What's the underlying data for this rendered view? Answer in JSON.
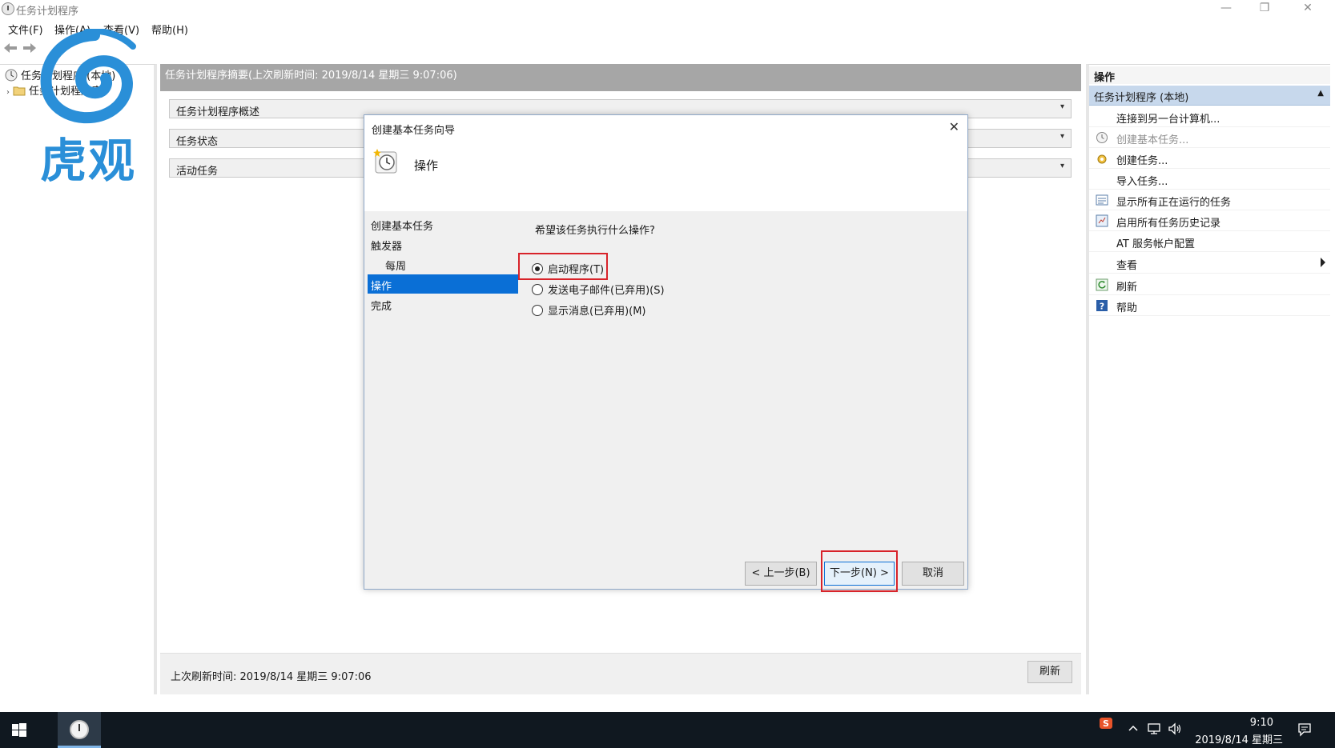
{
  "window": {
    "title": "任务计划程序",
    "minimize": "—",
    "restore": "❐",
    "close": "✕"
  },
  "menu": {
    "file": "文件(F)",
    "action": "操作(A)",
    "view": "查看(V)",
    "help": "帮助(H)"
  },
  "tree": {
    "root": "任务计划程序 (本地)",
    "library": "任务计划程序库"
  },
  "watermark": {
    "text": "虎观"
  },
  "center": {
    "header": "任务计划程序摘要(上次刷新时间: 2019/8/14 星期三 9:07:06)",
    "sections": [
      "任务计划程序概述",
      "任务状态",
      "活动任务"
    ],
    "footer_text": "上次刷新时间: 2019/8/14 星期三 9:07:06",
    "refresh_label": "刷新"
  },
  "actions": {
    "header": "操作",
    "group": "任务计划程序 (本地)",
    "items": [
      {
        "label": "连接到另一台计算机...",
        "icon": "none"
      },
      {
        "label": "创建基本任务...",
        "icon": "clock-icon"
      },
      {
        "label": "创建任务...",
        "icon": "new-task-icon"
      },
      {
        "label": "导入任务...",
        "icon": "none"
      },
      {
        "label": "显示所有正在运行的任务",
        "icon": "list-icon"
      },
      {
        "label": "启用所有任务历史记录",
        "icon": "history-icon"
      },
      {
        "label": "AT 服务帐户配置",
        "icon": "none"
      },
      {
        "label": "查看",
        "icon": "none"
      },
      {
        "label": "刷新",
        "icon": "refresh-icon"
      },
      {
        "label": "帮助",
        "icon": "help-icon"
      }
    ]
  },
  "dialog": {
    "title": "创建基本任务向导",
    "heading": "操作",
    "steps": [
      "创建基本任务",
      "触发器",
      "每周",
      "操作",
      "完成"
    ],
    "active_step": "操作",
    "question": "希望该任务执行什么操作?",
    "options": [
      {
        "label": "启动程序(T)",
        "selected": true
      },
      {
        "label": "发送电子邮件(已弃用)(S)",
        "selected": false
      },
      {
        "label": "显示消息(已弃用)(M)",
        "selected": false
      }
    ],
    "buttons": {
      "back": "< 上一步(B)",
      "next": "下一步(N) >",
      "cancel": "取消"
    },
    "highlight_color": "#d8232a",
    "active_color": "#0a6fd6"
  },
  "taskbar": {
    "time": "9:10",
    "date": "2019/8/14 星期三"
  }
}
